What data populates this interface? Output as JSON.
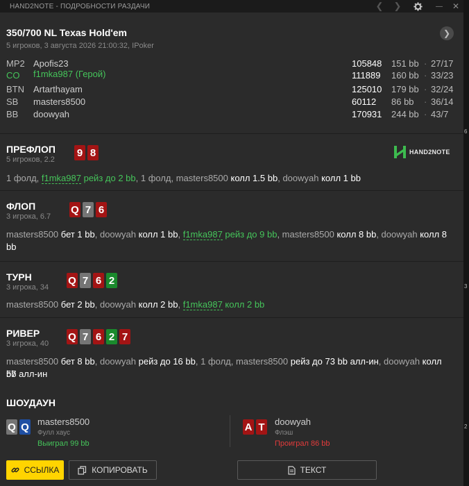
{
  "window": {
    "title": "HAND2NOTE - ПОДРОБНОСТИ РАЗДАЧИ",
    "controls": {
      "prev": "❮",
      "next": "❯",
      "minimize": "—",
      "close": "✕"
    }
  },
  "hand": {
    "title": "350/700 NL Texas Hold'em",
    "subtitle": "5 игроков, 3 августа 2026 21:00:32, IPoker",
    "next_arrow": "❯"
  },
  "players": [
    {
      "pos": "MP2",
      "name": "Apofis23",
      "stack": "105848",
      "bb": "151 bb",
      "sep": "·",
      "stat": "27/17"
    },
    {
      "pos": "CO",
      "name": "f1mka987 (Герой)",
      "stack": "111889",
      "bb": "160 bb",
      "sep": "·",
      "stat": "33/23",
      "hero": true
    },
    {
      "pos": "BTN",
      "name": "Artarthayam",
      "stack": "125010",
      "bb": "179 bb",
      "sep": "·",
      "stat": "32/24"
    },
    {
      "pos": "SB",
      "name": "masters8500",
      "stack": "60112",
      "bb": "86 bb",
      "sep": "·",
      "stat": "36/14"
    },
    {
      "pos": "BB",
      "name": "doowyah",
      "stack": "170931",
      "bb": "244 bb",
      "sep": "·",
      "stat": "43/7"
    }
  ],
  "logo": {
    "text": "HAND2NOTE"
  },
  "streets": {
    "preflop": {
      "title": "ПРЕФЛОП",
      "sub": "5 игроков, 2.2",
      "cards": [
        "9",
        "8"
      ],
      "line": {
        "a1": "1 фолд, ",
        "a2": "f1mka987",
        "a3": " рейз до 2 bb",
        "a4": ", 1 фолд, masters8500 ",
        "a5": "колл 1.5 bb",
        "a6": ", doowyah ",
        "a7": "колл 1 bb"
      }
    },
    "flop": {
      "title": "ФЛОП",
      "sub": "3 игрока, 6.7",
      "cards": [
        "Q",
        "7",
        "6"
      ],
      "line1": {
        "a1": "masters8500 ",
        "a2": "бет 1 bb",
        "a3": ", doowyah ",
        "a4": "колл 1 bb",
        "a5": ", ",
        "a6": "f1mka987",
        "a7": " рейз до 9 bb",
        "a8": ", masters8500 ",
        "a9": "колл 8 bb",
        "a10": ", doowyah ",
        "a11": "колл 8"
      },
      "line2": "bb"
    },
    "turn": {
      "title": "ТУРН",
      "sub": "3 игрока, 34",
      "cards": [
        "Q",
        "7",
        "6",
        "2"
      ],
      "line": {
        "a1": "masters8500 ",
        "a2": "бет 2 bb",
        "a3": ", doowyah ",
        "a4": "колл 2 bb",
        "a5": ", ",
        "a6": "f1mka987",
        "a7": " колл 2 bb"
      }
    },
    "river": {
      "title": "РИВЕР",
      "sub": "3 игрока, 40",
      "cards": [
        "Q",
        "7",
        "6",
        "2",
        "7"
      ],
      "line1": {
        "a1": "masters8500 ",
        "a2": "бет 8 bb",
        "a3": ", doowyah ",
        "a4": "рейз до 16 bb",
        "a5": ", 1 фолд, masters8500 ",
        "a6": "рейз до 73 bb алл-ин",
        "a7": ", doowyah ",
        "a8": "колл 57"
      },
      "line2": "bb алл-ин"
    }
  },
  "showdown": {
    "title": "ШОУДАУН",
    "left": {
      "cards": [
        "Q",
        "Q"
      ],
      "name": "masters8500",
      "combo": "Фулл хаус",
      "result": "Выиграл 99 bb"
    },
    "right": {
      "cards": [
        "A",
        "T"
      ],
      "name": "doowyah",
      "combo": "Флэш",
      "result": "Проиграл 86 bb"
    }
  },
  "buttons": {
    "link": "ССЫЛКА",
    "copy": "КОПИРОВАТЬ",
    "text": "ТЕКСТ"
  },
  "colors": {
    "hero_green": "#45c45a",
    "card_red": "#a31414",
    "card_gray": "#757575",
    "card_green": "#1a8a2d",
    "card_blue": "#1f4fa3",
    "accent_yellow": "#ffd400",
    "loss_red": "#e23b3b"
  },
  "side_marks": [
    "6",
    "3",
    "2"
  ]
}
